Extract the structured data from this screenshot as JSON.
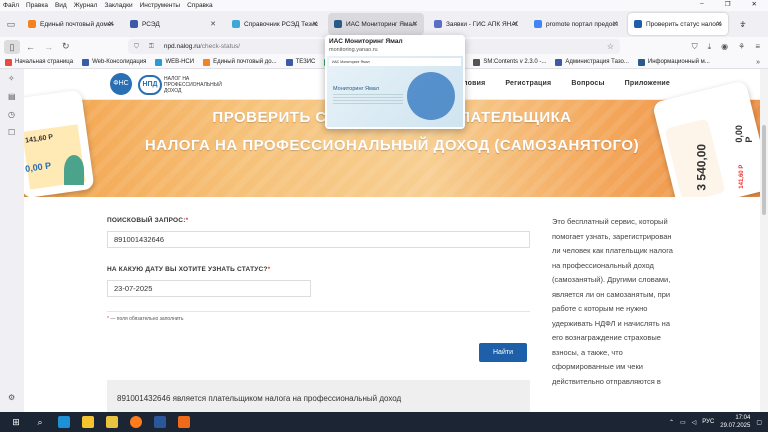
{
  "menubar": [
    "Файл",
    "Правка",
    "Вид",
    "Журнал",
    "Закладки",
    "Инструменты",
    "Справка"
  ],
  "window_controls": [
    "–",
    "❐",
    "✕"
  ],
  "tabs": [
    {
      "title": "Единый почтовый домен",
      "color": "#f58220",
      "active": false,
      "hover": false
    },
    {
      "title": "РСЭД",
      "color": "#3b5aa8",
      "active": false,
      "hover": false
    },
    {
      "title": "Справочник РСЭД Тезис",
      "color": "#3ea7d8",
      "active": false,
      "hover": false
    },
    {
      "title": "ИАС Мониторинг Ямал",
      "color": "#2a5a8a",
      "active": false,
      "hover": true
    },
    {
      "title": "Заявки - ГИС АПК ЯНАО",
      "color": "#5b6fc4",
      "active": false,
      "hover": false
    },
    {
      "title": "promote портал предоста",
      "color": "#4285f4",
      "active": false,
      "hover": false
    },
    {
      "title": "Проверить статус налогоп",
      "color": "#1d5fa8",
      "active": true,
      "hover": false
    }
  ],
  "tab_new": "+",
  "tab_list": "⌄",
  "navbar": {
    "url_host": "npd.nalog.ru",
    "url_path": "/check-status/"
  },
  "bookmarks": [
    {
      "label": "Начальная страница",
      "color": "#e74c3c"
    },
    {
      "label": "Web-Консолидация",
      "color": "#3b5aa8"
    },
    {
      "label": "WEB-НСИ",
      "color": "#2b9bd8"
    },
    {
      "label": "Единый почтовый до...",
      "color": "#f58220"
    },
    {
      "label": "ТЕЗИС",
      "color": "#3b5aa8"
    },
    {
      "label": "Кон",
      "color": "#27ae60"
    },
    {
      "label": "ал",
      "color": "#f58220"
    },
    {
      "label": "SM:Contents v 2.3.0 -...",
      "color": "#555555"
    },
    {
      "label": "Администрация Тазо...",
      "color": "#3b5aa8"
    },
    {
      "label": "Информационный м...",
      "color": "#2a5a8a"
    }
  ],
  "bookmarks_more": "»",
  "site": {
    "logo_fns": "ФНС",
    "logo_npd": "НПД",
    "logo_text": "Налог на профессиональный доход",
    "nav": [
      "Условия",
      "Регистрация",
      "Вопросы",
      "Приложение"
    ]
  },
  "banner": {
    "line1": "ПРОВЕРИТЬ СТАТУС НАЛОГОПЛАТЕЛЬЩИКА",
    "line2": "НАЛОГА НА ПРОФЕССИОНАЛЬНЫЙ ДОХОД (САМОЗАНЯТОГО)",
    "left_balance": "3 540,00",
    "left_small1": "141,60 Р",
    "left_small2": "0,00 Р",
    "right_balance": "3 540,00",
    "right_small1": "0,00 Р",
    "right_small2": "141,60 Р"
  },
  "form": {
    "query_label": "ПОИСКОВЫЙ ЗАПРОС:",
    "query_value": "891001432646",
    "date_label": "НА КАКУЮ ДАТУ ВЫ ХОТИТЕ УЗНАТЬ СТАТУС?",
    "date_value": "23-07-2025",
    "required_mark": "*",
    "required_note": " — поля обязательно заполнить",
    "submit_label": "Найти"
  },
  "result_text": "891001432646 является плательщиком налога на профессиональный доход",
  "side_text": "Это бесплатный сервис, который помогает узнать, зарегистрирован ли человек как плательщик налога на профессиональный доход (самозанятый). Другими словами, является ли он самозанятым, при работе с которым не нужно удерживать НДФЛ и начислять на его вознаграждение страховые взносы, а также, что сформированные им чеки действительно отправляются в",
  "tab_preview": {
    "title": "ИАС Мониторинг Ямал",
    "url": "monitoring.yanao.ru",
    "preview_header": "ИАС Мониторинг Ямал",
    "preview_title": "Мониторинг Ямал"
  },
  "taskbar": {
    "lang": "РУС",
    "time": "17:04",
    "date": "29.07.2025",
    "icons": [
      {
        "name": "windows-start-icon",
        "color": "#ffffff"
      },
      {
        "name": "search-icon",
        "color": "#ffffff"
      },
      {
        "name": "edge-icon",
        "color": "#1e90d6"
      },
      {
        "name": "explorer-icon",
        "color": "#f4c430"
      },
      {
        "name": "yandex-icon",
        "color": "#e9c440"
      },
      {
        "name": "firefox-icon",
        "color": "#ff7b1c"
      },
      {
        "name": "word-icon",
        "color": "#2b579a"
      },
      {
        "name": "app-icon",
        "color": "#f06a1a"
      }
    ]
  }
}
